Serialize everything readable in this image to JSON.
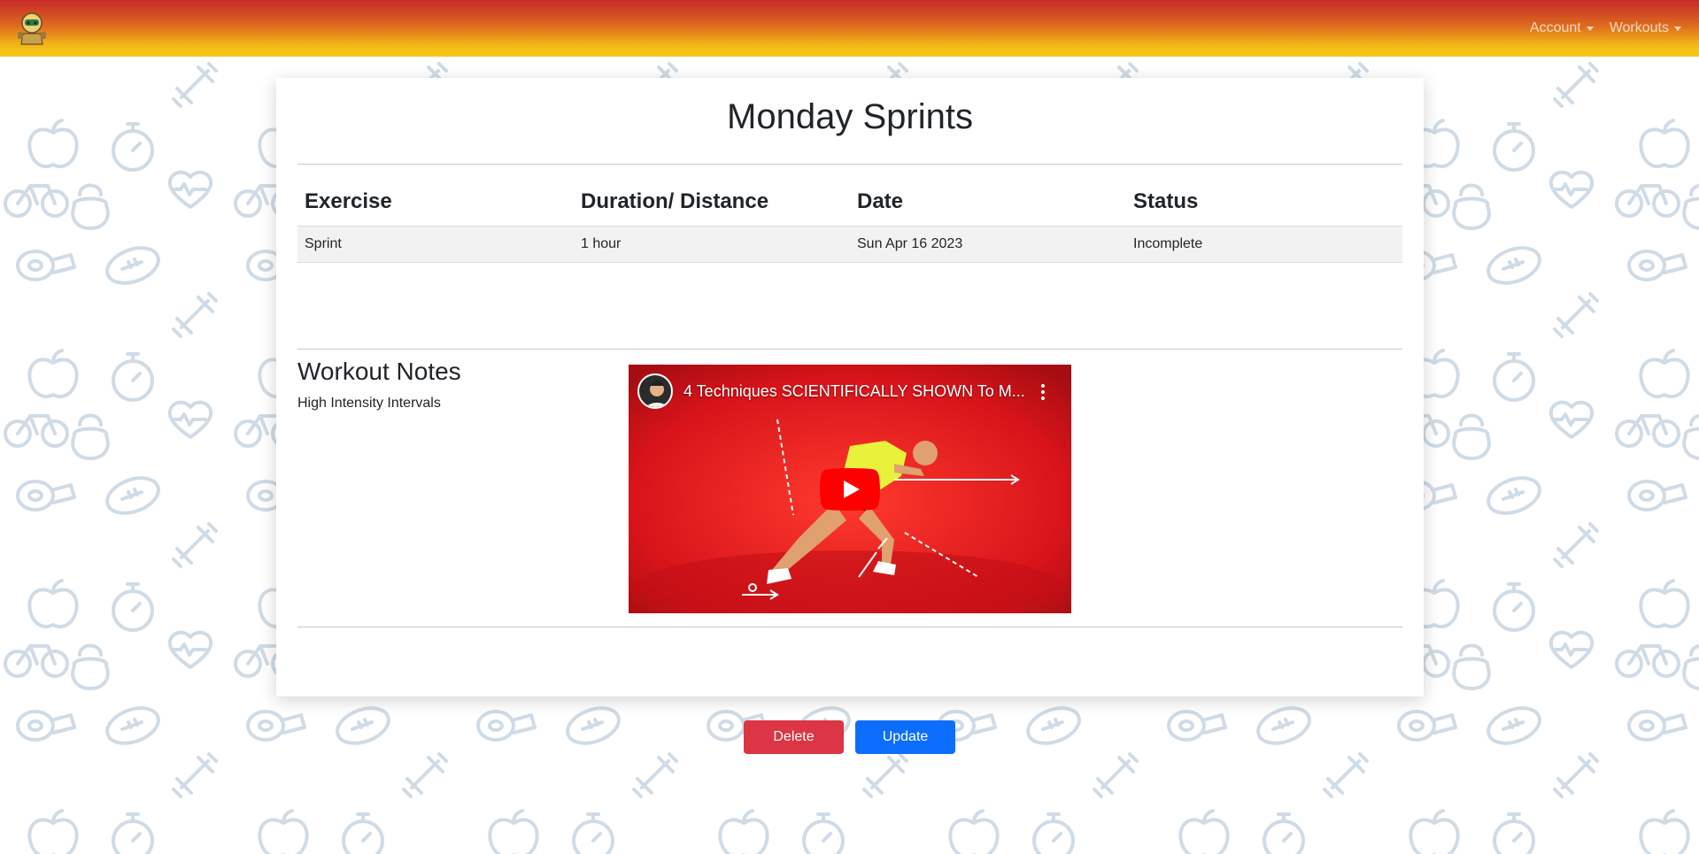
{
  "navbar": {
    "account_label": "Account",
    "workouts_label": "Workouts",
    "gradient_top": "#c72a2a",
    "gradient_bottom": "#f6c815"
  },
  "workout": {
    "title": "Monday Sprints",
    "table": {
      "headers": [
        "Exercise",
        "Duration/ Distance",
        "Date",
        "Status"
      ],
      "rows": [
        [
          "Sprint",
          "1 hour",
          "Sun Apr 16 2023",
          "Incomplete"
        ]
      ]
    },
    "notes_heading": "Workout Notes",
    "notes_text": "High Intensity Intervals"
  },
  "video": {
    "title": "4 Techniques SCIENTIFICALLY SHOWN To M...",
    "play_icon": "play-icon",
    "menu_icon": "kebab-menu-icon"
  },
  "actions": {
    "delete_label": "Delete",
    "update_label": "Update",
    "delete_color": "#dc3545",
    "update_color": "#0d6efd"
  }
}
